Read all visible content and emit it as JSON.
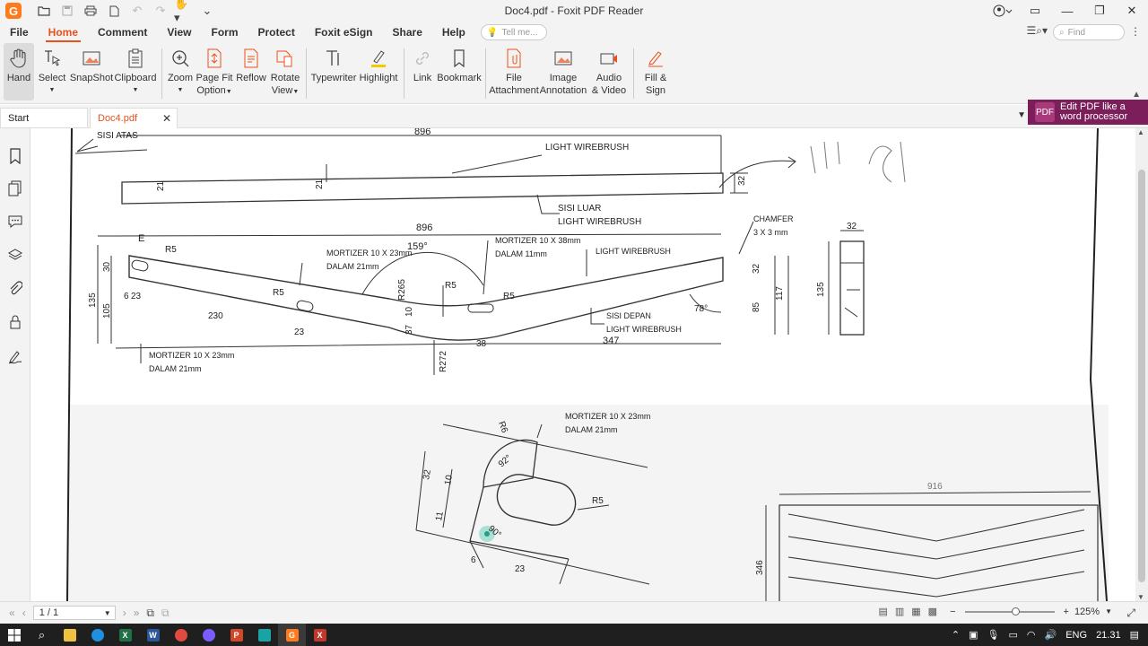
{
  "app": {
    "title": "Doc4.pdf - Foxit PDF Reader"
  },
  "menu": {
    "tabs": [
      "File",
      "Home",
      "Comment",
      "View",
      "Form",
      "Protect",
      "Foxit eSign",
      "Share",
      "Help"
    ],
    "active": "Home",
    "tell_me_placeholder": "Tell me...",
    "find_placeholder": "Find"
  },
  "ribbon": {
    "hand": "Hand",
    "select": "Select",
    "snapshot": "SnapShot",
    "clipboard": "Clipboard",
    "zoom": "Zoom",
    "page_fit": "Page Fit",
    "page_fit_2": "Option",
    "reflow": "Reflow",
    "rotate": "Rotate",
    "rotate_2": "View",
    "typewriter": "Typewriter",
    "highlight": "Highlight",
    "link": "Link",
    "bookmark": "Bookmark",
    "file_att": "File",
    "file_att_2": "Attachment",
    "image_ann": "Image",
    "image_ann_2": "Annotation",
    "audio": "Audio",
    "audio_2": "& Video",
    "fill": "Fill &",
    "fill_2": "Sign"
  },
  "doc_tabs": {
    "start": "Start",
    "doc": "Doc4.pdf"
  },
  "promo": {
    "line1": "Edit PDF like a",
    "line2": "word processor"
  },
  "drawing": {
    "sisi_atas": "SISI ATAS",
    "dim_896_top": "896",
    "light_wirebrush_1": "LIGHT WIREBRUSH",
    "sisi_luar": "SISI LUAR",
    "light_wirebrush_2": "LIGHT WIREBRUSH",
    "dim_21a": "21",
    "dim_21b": "21",
    "dim_32_top": "32",
    "dim_896_mid": "896",
    "label_e": "E",
    "r5_a": "R5",
    "r5_b": "R5",
    "r5_c": "R5",
    "r5_d": "R5",
    "angle_159": "159°",
    "r265": "R265",
    "mortizer_1a": "MORTIZER 10 X 23mm",
    "mortizer_1b": "DALAM 21mm",
    "mortizer_2a": "MORTIZER 10 X 38mm",
    "mortizer_2b": "DALAM 11mm",
    "light_wirebrush_3": "LIGHT WIREBRUSH",
    "chamfer_a": "CHAMFER",
    "chamfer_b": "3 X 3 mm",
    "dim_32_side": "32",
    "dim_135_side": "135",
    "dim_30": "30",
    "dim_135": "135",
    "dim_105": "105",
    "dim_6": "6",
    "dim_23a": "23",
    "dim_230": "230",
    "dim_23b": "23",
    "dim_10": "10",
    "dim_37": "37",
    "dim_38": "38",
    "dim_347": "347",
    "r272": "R272",
    "sisi_depan": "SISI DEPAN",
    "light_wirebrush_4": "LIGHT WIREBRUSH",
    "angle_78": "78°",
    "dim_32_r": "32",
    "dim_85": "85",
    "dim_117": "117",
    "mortizer_3a": "MORTIZER 10 X 23mm",
    "mortizer_3b": "DALAM 21mm",
    "mortizer_4a": "MORTIZER 10 X 23mm",
    "mortizer_4b": "DALAM 21mm",
    "r6": "R6",
    "angle_92": "92°",
    "dim_32_detail": "32",
    "dim_10_detail": "10",
    "dim_11_detail": "11",
    "dim_6_detail": "6",
    "dim_23_detail": "23",
    "r5_detail": "R5",
    "angle_90": "90°",
    "dim_916": "916",
    "dim_346": "346"
  },
  "status": {
    "page": "1 / 1",
    "zoom": "125%"
  },
  "taskbar": {
    "lang": "ENG",
    "time": "21.31"
  }
}
